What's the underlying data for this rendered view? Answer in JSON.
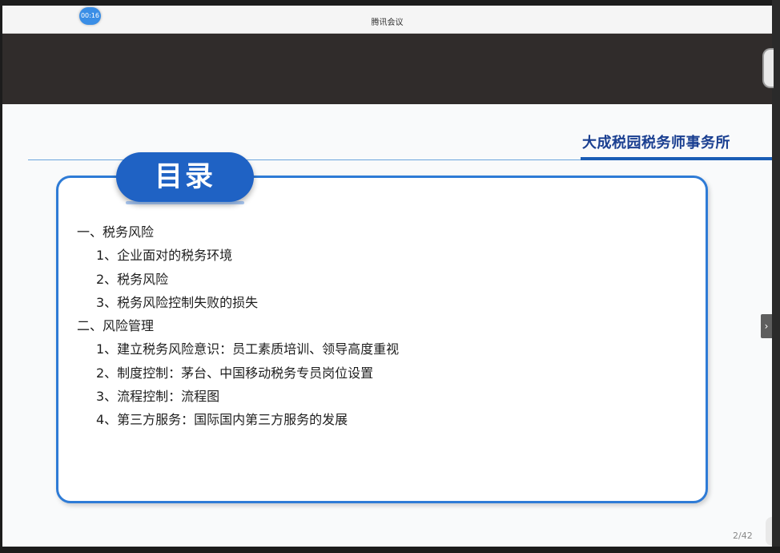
{
  "window": {
    "title": "腾讯会议",
    "timer": "00:16"
  },
  "slide": {
    "firm_name": "大成税园税务师事务所",
    "toc_title": "目录",
    "items": [
      "一、税务风险",
      "1、企业面对的税务环境",
      "2、税务风险",
      "3、税务风险控制失败的损失",
      "二、风险管理",
      "1、建立税务风险意识：员工素质培训、领导高度重视",
      "2、制度控制：茅台、中国移动税务专员岗位设置",
      "3、流程控制：流程图",
      "4、第三方服务：国际国内第三方服务的发展"
    ],
    "page_number": "2/42"
  },
  "controls": {
    "next_arrow_icon": "chevron-right-icon",
    "next_arrow_glyph": "›"
  },
  "colors": {
    "accent": "#1f62c4",
    "firm_text": "#1a3f91",
    "dark_band": "#302c2b"
  }
}
